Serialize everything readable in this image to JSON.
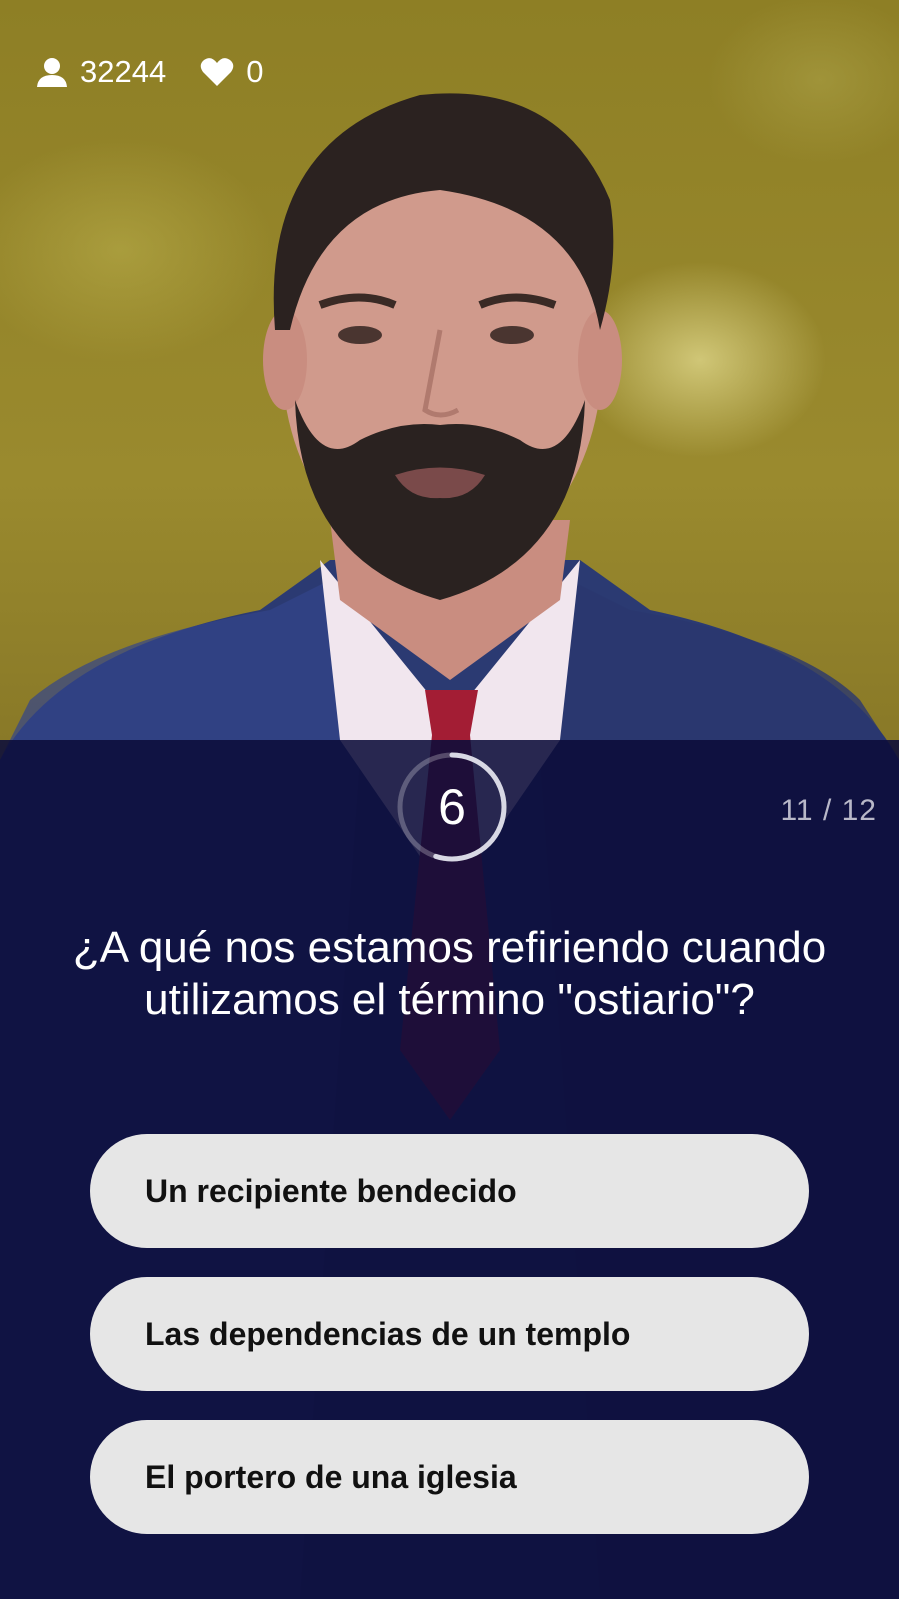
{
  "stats": {
    "viewers_count": "32244",
    "likes_count": "0",
    "viewers_icon": "person-icon",
    "likes_icon": "heart-icon"
  },
  "timer": {
    "seconds": "6",
    "remaining_fraction": 0.55
  },
  "progress": {
    "label": "11 / 12"
  },
  "question": {
    "text": "¿A qué nos estamos refiriendo cuando utilizamos el término \"ostiario\"?"
  },
  "answers": [
    {
      "label": "Un recipiente bendecido"
    },
    {
      "label": "Las dependencias de un templo"
    },
    {
      "label": "El portero de una iglesia"
    }
  ],
  "colors": {
    "overlay": "#0b0d3a",
    "answer_bg": "#e6e6e6",
    "answer_text": "#111111",
    "text_primary": "#ffffff",
    "text_secondary": "#b8b8c8"
  }
}
